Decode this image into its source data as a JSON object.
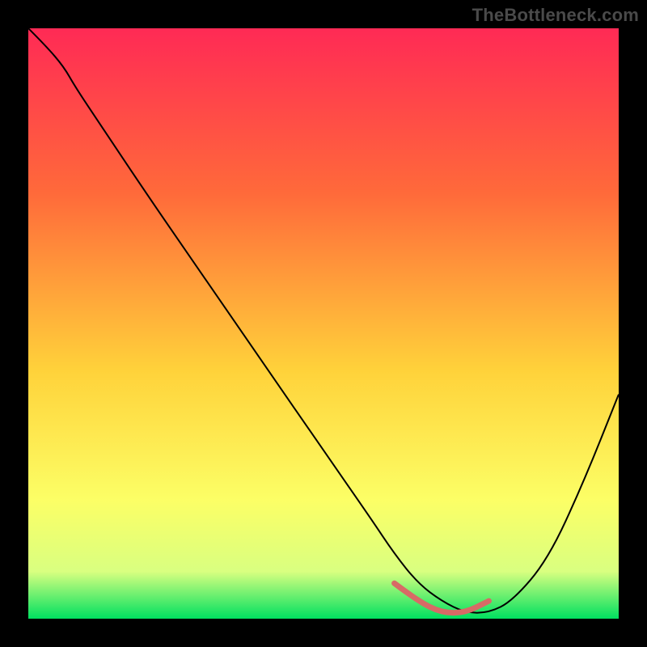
{
  "watermark": "TheBottleneck.com",
  "colors": {
    "page_bg": "#000000",
    "gradient_top": "#ff2a55",
    "gradient_upper_mid": "#ff6a3a",
    "gradient_mid": "#ffd23a",
    "gradient_lower_mid": "#fcff66",
    "gradient_near_bottom": "#d9ff80",
    "gradient_bottom": "#00e060",
    "curve": "#000000",
    "highlight": "#d86a66"
  },
  "chart_data": {
    "type": "line",
    "title": "",
    "xlabel": "",
    "ylabel": "",
    "xlim": [
      0,
      100
    ],
    "ylim": [
      0,
      100
    ],
    "grid": false,
    "series": [
      {
        "name": "curve",
        "x": [
          0,
          3,
          6,
          8,
          12,
          20,
          30,
          40,
          50,
          58,
          62,
          66,
          70,
          74,
          78,
          82,
          88,
          94,
          100
        ],
        "y": [
          100,
          97,
          93.5,
          90,
          84,
          72,
          57.5,
          43,
          28.5,
          17,
          11,
          6,
          3,
          1,
          1,
          3,
          10,
          23,
          38
        ]
      }
    ],
    "annotations": [
      {
        "name": "highlight-segment",
        "x": [
          62,
          66,
          70,
          74,
          78
        ],
        "y": [
          6,
          3,
          1,
          1,
          3
        ]
      }
    ],
    "gradient_stops": [
      {
        "offset": 0,
        "color": "#ff2a55"
      },
      {
        "offset": 28,
        "color": "#ff6a3a"
      },
      {
        "offset": 58,
        "color": "#ffd23a"
      },
      {
        "offset": 80,
        "color": "#fcff66"
      },
      {
        "offset": 92,
        "color": "#d9ff80"
      },
      {
        "offset": 100,
        "color": "#00e060"
      }
    ]
  }
}
